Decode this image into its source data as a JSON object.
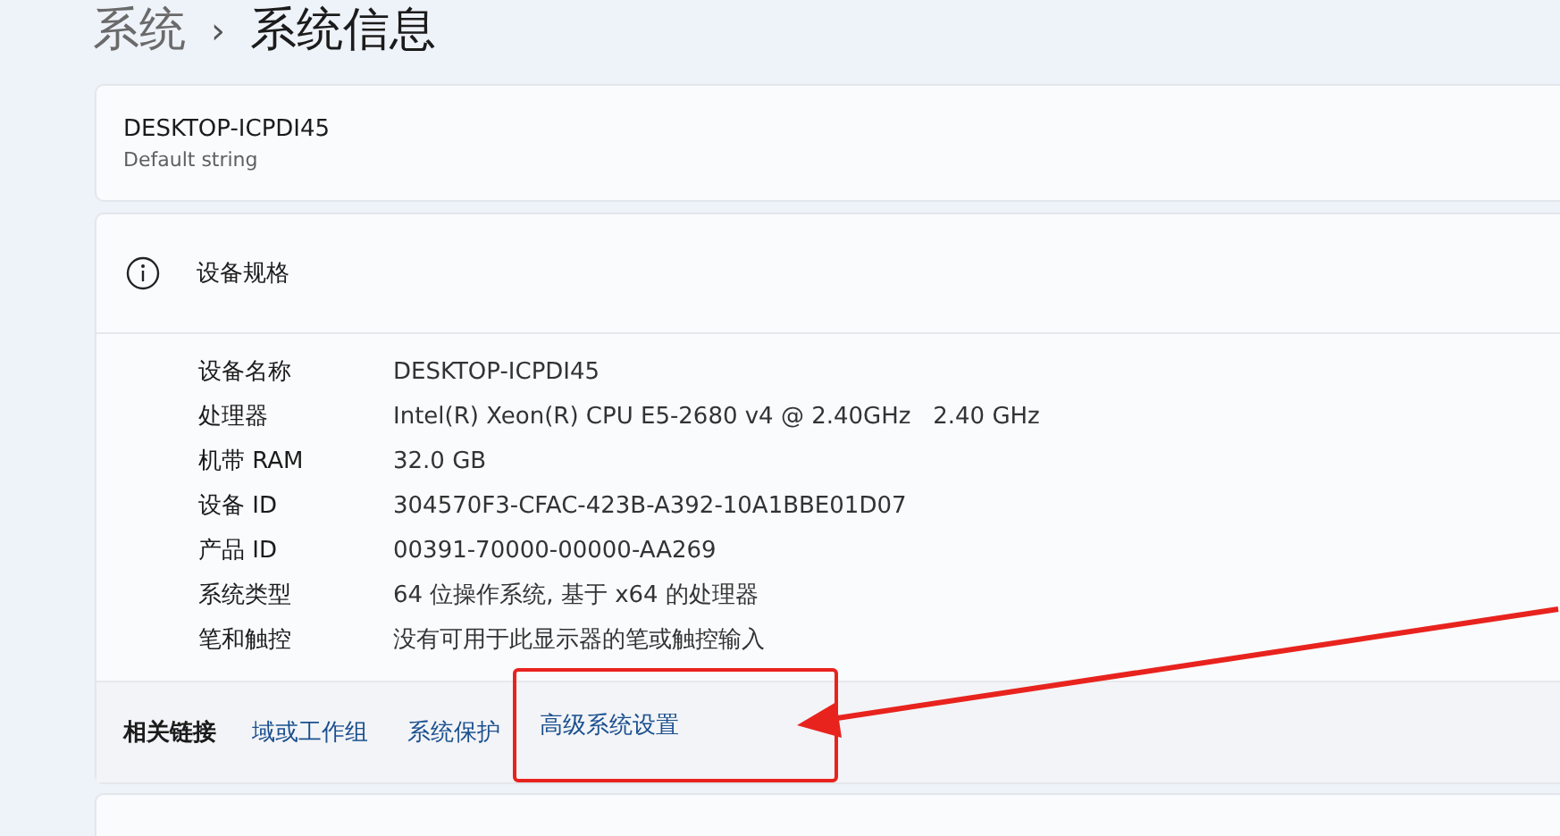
{
  "breadcrumb": {
    "parent": "系统",
    "separator": "›",
    "current": "系统信息"
  },
  "device_card": {
    "name": "DESKTOP-ICPDI45",
    "subtitle": "Default string"
  },
  "specs": {
    "title": "设备规格",
    "rows": [
      {
        "label": "设备名称",
        "value": "DESKTOP-ICPDI45"
      },
      {
        "label": "处理器",
        "value": "Intel(R) Xeon(R) CPU E5-2680 v4 @ 2.40GHz   2.40 GHz"
      },
      {
        "label": "机带 RAM",
        "value": "32.0 GB"
      },
      {
        "label": "设备 ID",
        "value": "304570F3-CFAC-423B-A392-10A1BBE01D07"
      },
      {
        "label": "产品 ID",
        "value": "00391-70000-00000-AA269"
      },
      {
        "label": "系统类型",
        "value": "64 位操作系统, 基于 x64 的处理器"
      },
      {
        "label": "笔和触控",
        "value": "没有可用于此显示器的笔或触控输入"
      }
    ]
  },
  "related_links": {
    "title": "相关链接",
    "links": [
      {
        "label": "域或工作组",
        "highlighted": false
      },
      {
        "label": "系统保护",
        "highlighted": false
      },
      {
        "label": "高级系统设置",
        "highlighted": true
      }
    ]
  }
}
